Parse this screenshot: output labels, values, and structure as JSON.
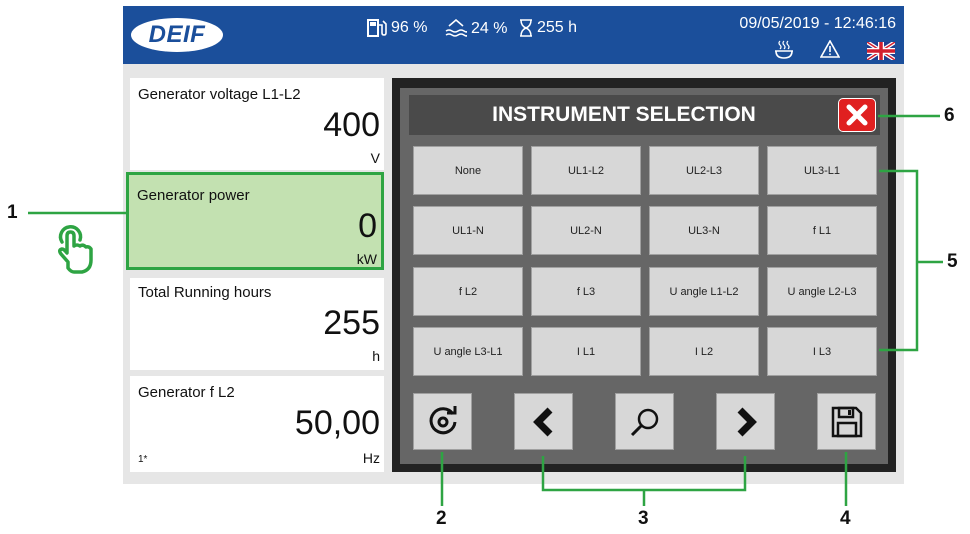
{
  "header": {
    "logo_text": "DEIF",
    "fuel": "96 %",
    "water": "24 %",
    "hours": "255 h",
    "datetime": "09/05/2019 - 12:46:16"
  },
  "panels": [
    {
      "title": "Generator voltage L1-L2",
      "value": "400",
      "unit": "V",
      "foot": ""
    },
    {
      "title": "Generator power",
      "value": "0",
      "unit": "kW",
      "foot": ""
    },
    {
      "title": "Total Running hours",
      "value": "255",
      "unit": "h",
      "foot": ""
    },
    {
      "title": "Generator f L2",
      "value": "50,00",
      "unit": "Hz",
      "foot": "1*"
    }
  ],
  "dialog": {
    "title": "INSTRUMENT SELECTION",
    "options": [
      "None",
      "UL1-L2",
      "UL2-L3",
      "UL3-L1",
      "UL1-N",
      "UL2-N",
      "UL3-N",
      "f L1",
      "f L2",
      "f L3",
      "U angle L1-L2",
      "U angle L2-L3",
      "U angle L3-L1",
      "I L1",
      "I L2",
      "I L3"
    ]
  },
  "callouts": {
    "c1": "1",
    "c2": "2",
    "c3": "3",
    "c4": "4",
    "c5": "5",
    "c6": "6"
  },
  "colors": {
    "header_blue": "#1b4f9b",
    "accent_green": "#2ea443",
    "selected_fill": "#c3e1b1",
    "close_red": "#e02020"
  },
  "icons": [
    "fuel-icon",
    "water-level-icon",
    "hourglass-icon",
    "heater-icon",
    "warning-icon",
    "uk-flag-icon",
    "touch-hand-icon",
    "refresh-icon",
    "chevron-left-icon",
    "search-icon",
    "chevron-right-icon",
    "save-icon",
    "close-icon"
  ]
}
